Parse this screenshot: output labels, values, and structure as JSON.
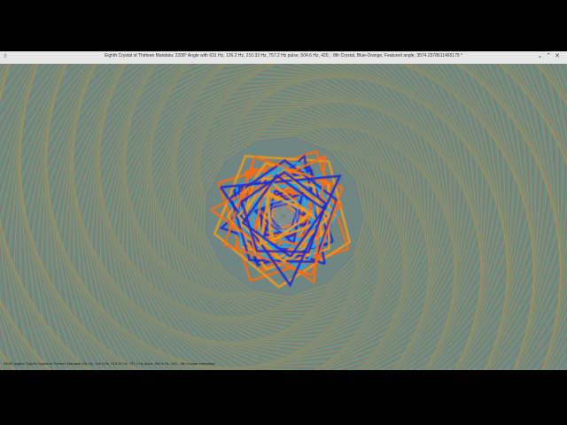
{
  "window": {
    "title": "Eighth Crystal of Thirteen Mandala: 2208° Angle with 631 Hz, 126.2 Hz, 210.33 Hz, 757.2 Hz pulse, 504.6 Hz, 420, : 8th Crystal, Blue-Orange, Featured angle, 3574.2378611465175 °",
    "app_icon": "app-icon",
    "controls": [
      "⌄",
      "⌃",
      "✕"
    ]
  },
  "status_text": "2208° angles: Eighth Crystal of Thirteen Mandala 631 Hz, 126.2 Hz, 210.33 Hz, 757.2 Hz pulse, 504.6 Hz, 420, : 8th Crystal Interactive",
  "colors": {
    "background": "#6e8783",
    "outer": [
      "#d04a5a",
      "#4fbf6a",
      "#d9b84a"
    ],
    "inner": [
      "#1a2bd6",
      "#ff6a10",
      "#f29a1a",
      "#22a6e6"
    ]
  }
}
